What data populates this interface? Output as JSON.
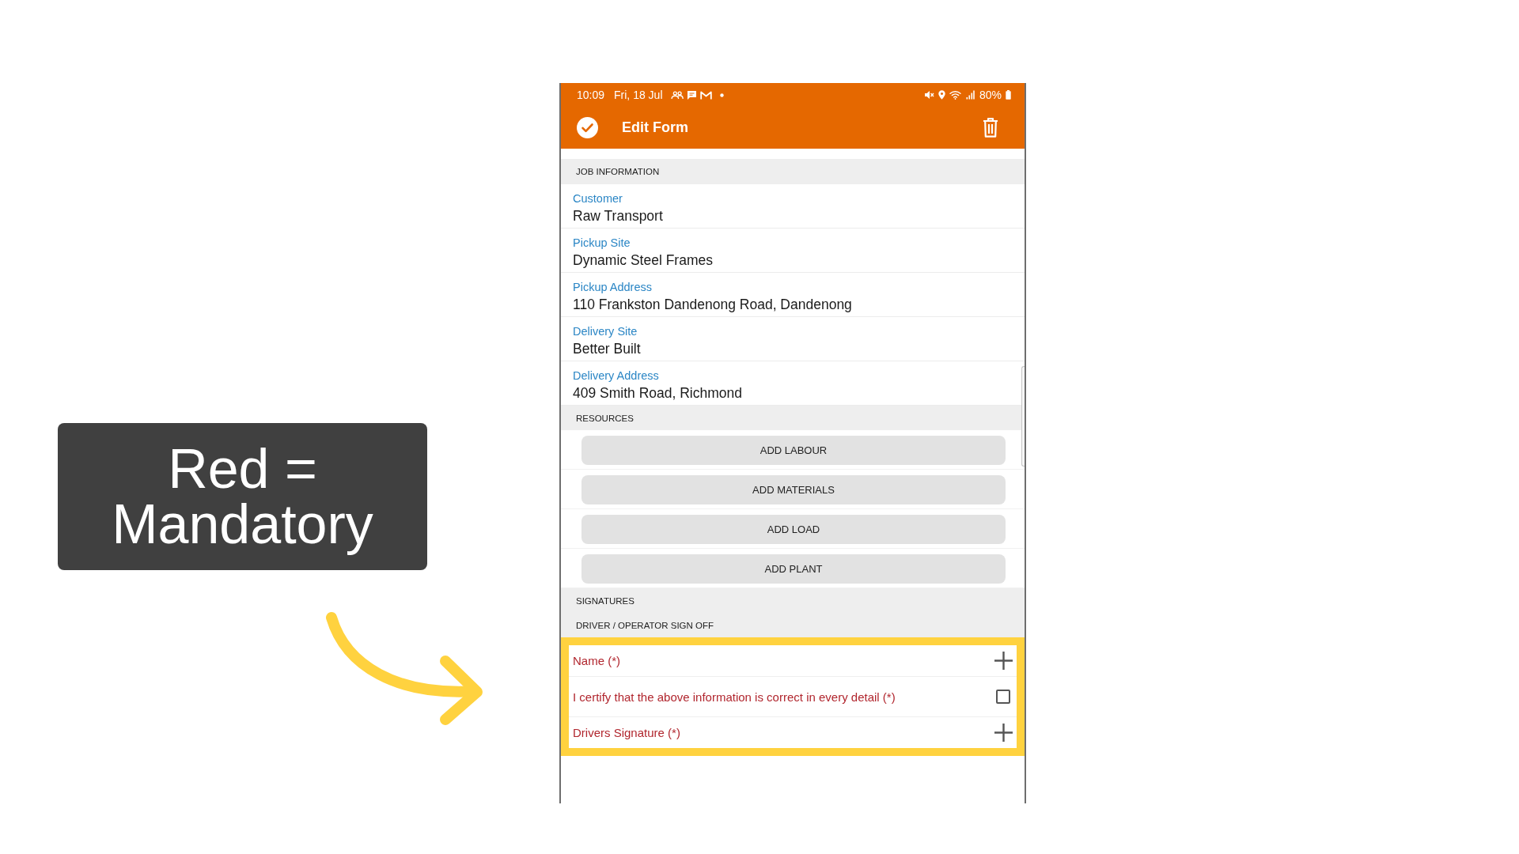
{
  "callout": {
    "text": "Red = Mandatory"
  },
  "status_bar": {
    "time": "10:09",
    "date": "Fri, 18 Jul",
    "battery": "80%"
  },
  "app_bar": {
    "title": "Edit Form"
  },
  "sections": [
    {
      "kind": "fields",
      "title": "JOB INFORMATION",
      "fields": [
        {
          "label": "Customer",
          "value": "Raw Transport"
        },
        {
          "label": "Pickup Site",
          "value": "Dynamic Steel Frames"
        },
        {
          "label": "Pickup Address",
          "value": "110 Frankston Dandenong Road, Dandenong"
        },
        {
          "label": "Delivery Site",
          "value": "Better Built"
        },
        {
          "label": "Delivery Address",
          "value": "409 Smith Road, Richmond"
        }
      ]
    },
    {
      "kind": "buttons",
      "title": "RESOURCES",
      "buttons": [
        "ADD LABOUR",
        "ADD MATERIALS",
        "ADD LOAD",
        "ADD PLANT"
      ]
    },
    {
      "kind": "header",
      "title": "SIGNATURES"
    },
    {
      "kind": "signoff",
      "title": "DRIVER / OPERATOR SIGN OFF",
      "highlighted": true,
      "items": [
        {
          "kind": "add",
          "label": "Name (*)",
          "required": true
        },
        {
          "kind": "checkbox",
          "label": "I certify that the above information is correct in every detail (*)",
          "required": true,
          "checked": false
        },
        {
          "kind": "add",
          "label": "Drivers Signature (*)",
          "required": true
        }
      ]
    }
  ]
}
